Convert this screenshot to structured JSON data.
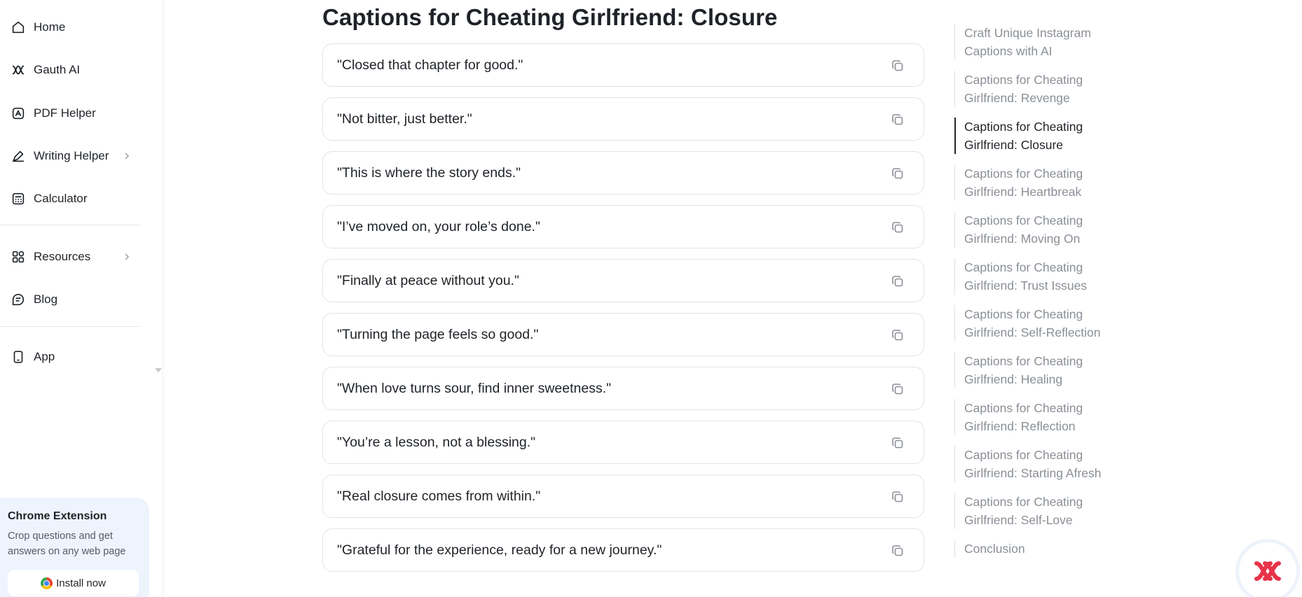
{
  "sidebar": {
    "nav": [
      {
        "label": "Home",
        "icon": "home-icon"
      },
      {
        "label": "Gauth AI",
        "icon": "gauth-ai-icon"
      },
      {
        "label": "PDF Helper",
        "icon": "pdf-icon"
      },
      {
        "label": "Writing Helper",
        "icon": "pen-icon",
        "has_submenu": true
      },
      {
        "label": "Calculator",
        "icon": "calculator-icon"
      },
      {
        "label": "Resources",
        "icon": "grid-icon",
        "has_submenu": true
      },
      {
        "label": "Blog",
        "icon": "blog-icon"
      },
      {
        "label": "App",
        "icon": "phone-icon"
      }
    ],
    "extension": {
      "title": "Chrome Extension",
      "description": "Crop questions and get answers on any web page",
      "button_label": "Install now"
    }
  },
  "main": {
    "title": "Captions for Cheating Girlfriend: Closure",
    "captions": [
      "\"Closed that chapter for good.\"",
      "\"Not bitter, just better.\"",
      "\"This is where the story ends.\"",
      "\"I’ve moved on, your role’s done.\"",
      "\"Finally at peace without you.\"",
      "\"Turning the page feels so good.\"",
      "\"When love turns sour, find inner sweetness.\"",
      "\"You’re a lesson, not a blessing.\"",
      "\"Real closure comes from within.\"",
      "\"Grateful for the experience, ready for a new journey.\""
    ]
  },
  "toc": {
    "items": [
      {
        "label": "Craft Unique Instagram Captions with AI"
      },
      {
        "label": "Captions for Cheating Girlfriend: Revenge"
      },
      {
        "label": "Captions for Cheating Girlfriend: Closure",
        "active": true
      },
      {
        "label": "Captions for Cheating Girlfriend: Heartbreak"
      },
      {
        "label": "Captions for Cheating Girlfriend: Moving On"
      },
      {
        "label": "Captions for Cheating Girlfriend: Trust Issues"
      },
      {
        "label": "Captions for Cheating Girlfriend: Self-Reflection"
      },
      {
        "label": "Captions for Cheating Girlfriend: Healing"
      },
      {
        "label": "Captions for Cheating Girlfriend: Reflection"
      },
      {
        "label": "Captions for Cheating Girlfriend: Starting Afresh"
      },
      {
        "label": "Captions for Cheating Girlfriend: Self-Love"
      },
      {
        "label": "Conclusion"
      }
    ]
  },
  "colors": {
    "text": "#1f2328",
    "muted": "#8a8f96",
    "brand": "#e8334a",
    "extension_bg": "#eef4fd"
  }
}
